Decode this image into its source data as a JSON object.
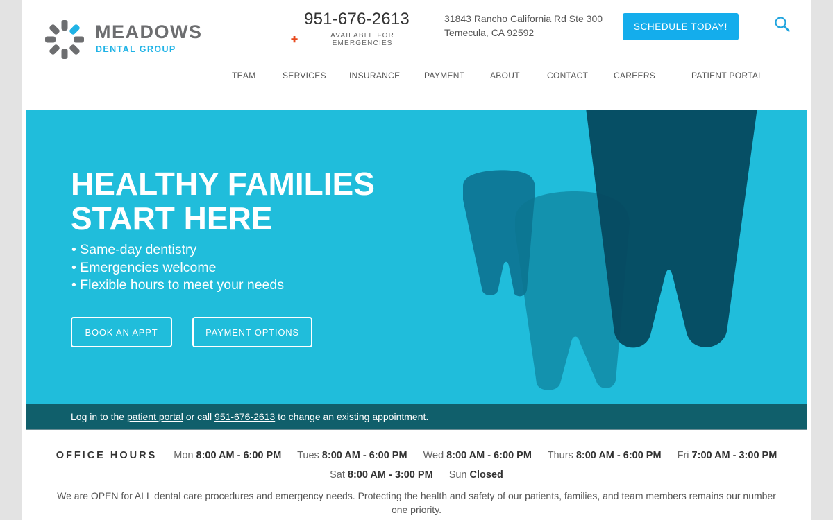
{
  "brand": {
    "name": "MEADOWS",
    "subtitle": "DENTAL GROUP",
    "primary_gray": "#6d6e70",
    "accent_blue": "#20b3e6"
  },
  "header": {
    "phone": "951-676-2613",
    "emergency_label": "AVAILABLE FOR EMERGENCIES",
    "emergency_icon": "plus-icon",
    "address_line1": "31843 Rancho California Rd Ste 300",
    "address_line2": "Temecula, CA 92592",
    "schedule_button": "SCHEDULE TODAY!",
    "search_icon": "search-icon"
  },
  "nav": {
    "items": [
      {
        "label": "TEAM"
      },
      {
        "label": "SERVICES"
      },
      {
        "label": "INSURANCE"
      },
      {
        "label": "PAYMENT"
      },
      {
        "label": "ABOUT"
      },
      {
        "label": "CONTACT"
      },
      {
        "label": "CAREERS"
      },
      {
        "label": "PATIENT PORTAL"
      }
    ]
  },
  "hero": {
    "title_line1": "HEALTHY FAMILIES",
    "title_line2": "START HERE",
    "bullets": [
      "Same-day dentistry",
      "Emergencies welcome",
      "Flexible hours to meet your needs"
    ],
    "book_button": "BOOK AN APPT",
    "payment_button": "PAYMENT OPTIONS",
    "background_color": "#20bddb"
  },
  "portal_bar": {
    "text_before": "Log in to the ",
    "portal_link": "patient portal",
    "text_middle": " or call ",
    "phone_link": "951-676-2613",
    "text_after": " to change an existing appointment."
  },
  "office_hours": {
    "title": "OFFICE HOURS",
    "days": [
      {
        "day": "Mon",
        "time": "8:00 AM - 6:00 PM"
      },
      {
        "day": "Tues",
        "time": "8:00 AM - 6:00 PM"
      },
      {
        "day": "Wed",
        "time": "8:00 AM - 6:00 PM"
      },
      {
        "day": "Thurs",
        "time": "8:00 AM - 6:00 PM"
      },
      {
        "day": "Fri",
        "time": "7:00 AM - 3:00 PM"
      },
      {
        "day": "Sat",
        "time": "8:00 AM - 3:00 PM"
      },
      {
        "day": "Sun",
        "time": "Closed"
      }
    ]
  },
  "notice": "We are OPEN for ALL dental care procedures and emergency needs. Protecting the health and safety of our patients, families, and team members remains our number one priority."
}
